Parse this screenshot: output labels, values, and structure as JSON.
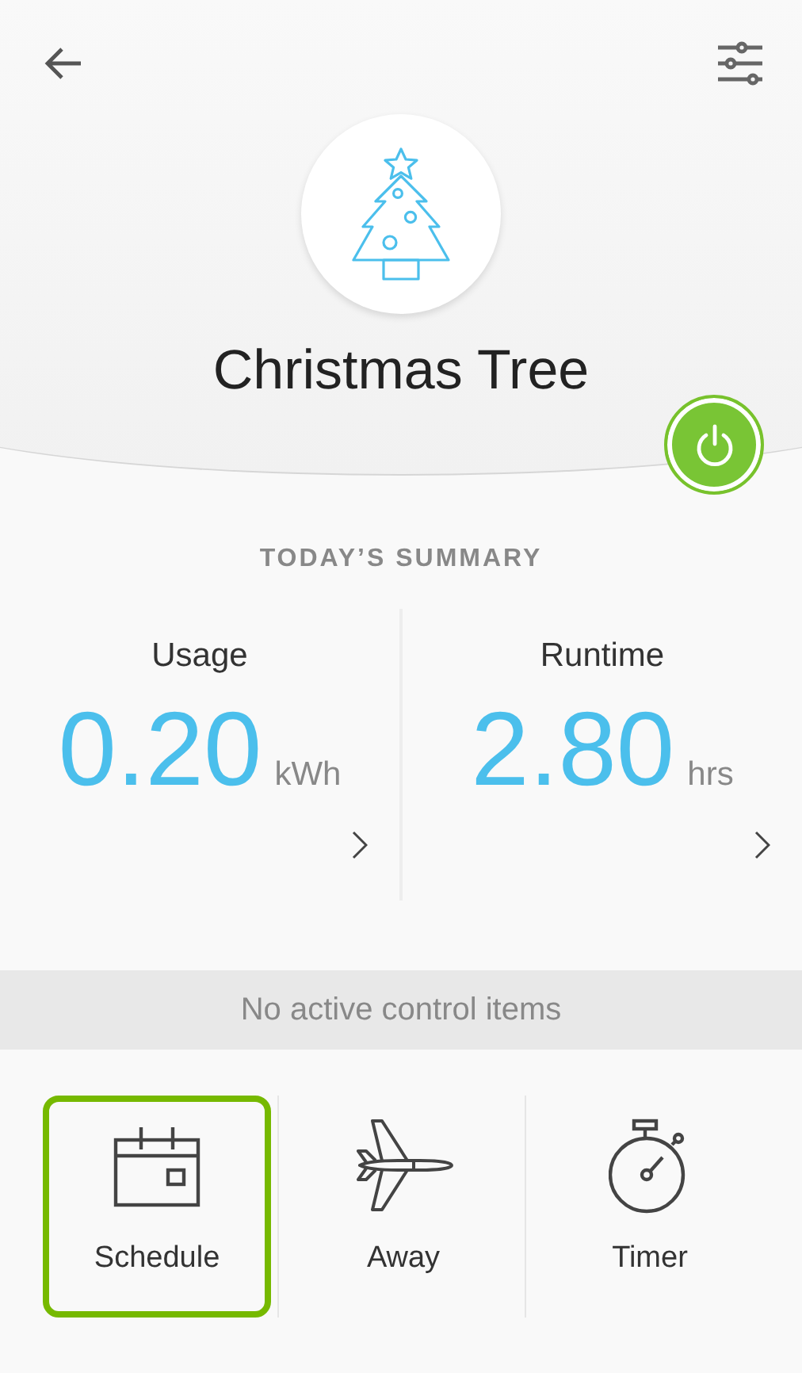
{
  "device": {
    "title": "Christmas Tree",
    "on": true
  },
  "summary": {
    "title": "TODAY’S SUMMARY",
    "metrics": [
      {
        "label": "Usage",
        "value": "0.20",
        "unit": "kWh"
      },
      {
        "label": "Runtime",
        "value": "2.80",
        "unit": "hrs"
      }
    ]
  },
  "notice": "No active control items",
  "controls": [
    {
      "kind": "schedule",
      "label": "Schedule",
      "selected": true
    },
    {
      "kind": "away",
      "label": "Away",
      "selected": false
    },
    {
      "kind": "timer",
      "label": "Timer",
      "selected": false
    }
  ]
}
